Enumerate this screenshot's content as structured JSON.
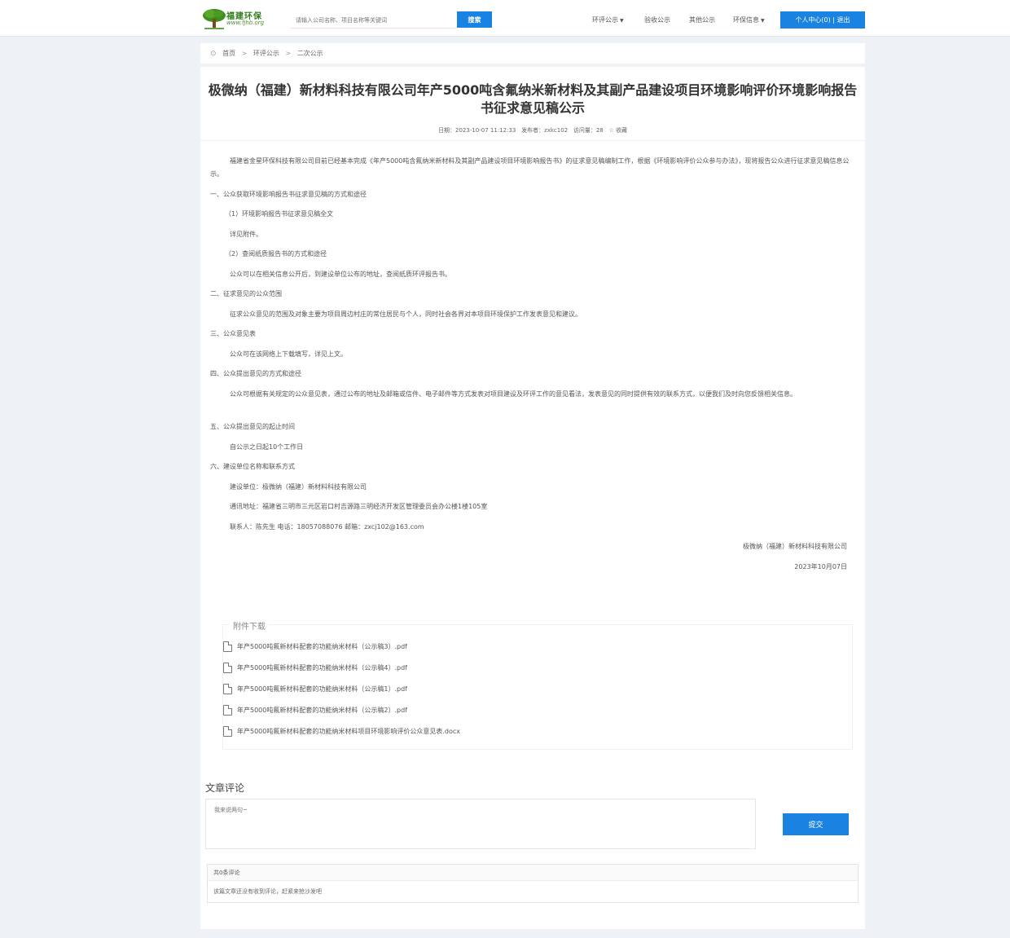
{
  "header": {
    "logo_text": "福建环保",
    "logo_domain": "www.fjhb.org",
    "search_placeholder": "请输入公司名称、项目名称等关键词",
    "search_button": "搜索",
    "nav": [
      {
        "label": "环评公示",
        "dropdown": true
      },
      {
        "label": "验收公示",
        "dropdown": false
      },
      {
        "label": "其他公示",
        "dropdown": false
      },
      {
        "label": "环保信息",
        "dropdown": true
      }
    ],
    "user_button": "个人中心(0) | 退出"
  },
  "breadcrumb": [
    "首页",
    "环评公示",
    "二次公示"
  ],
  "article": {
    "title": "极微纳（福建）新材料科技有限公司年产5000吨含氟纳米新材料及其副产品建设项目环境影响评价环境影响报告书征求意见稿公示",
    "meta": {
      "date": "日期：2023-10-07 11:12:33",
      "publisher": "发布者：zxkc102",
      "views": "访问量：28",
      "favorite": "收藏"
    },
    "paragraphs": [
      "福建省金星环保科技有限公司目前已经基本完成《年产5000吨含氟纳米新材料及其副产品建设项目环境影响报告书》的征求意见稿编制工作，根据《环境影响评价公众参与办法》，现将报告公众进行征求意见稿信息公示。",
      "一、公众获取环境影响报告书征求意见稿的方式和途径",
      "（1）环境影响报告书征求意见稿全文",
      "详见附件。",
      "（2）查阅纸质报告书的方式和途径",
      "公众可以在相关信息公开后，到建设单位公布的地址，查阅纸质环评报告书。",
      "二、征求意见的公众范围",
      "征求公众意见的范围及对象主要为项目周边村庄的常住居民与个人，同时社会各界对本项目环境保护工作发表意见和建议。",
      "三、公众意见表",
      "公众可在该网络上下载填写，详见上文。",
      "四、公众提出意见的方式和途径",
      "公众可根据有关规定的公众意见表，通过公布的地址及邮箱或信件、电子邮件等方式发表对项目建设及环评工作的意见看法，发表意见的同时提供有效的联系方式，以便我们及时向您反馈相关信息。",
      "五、公众提出意见的起止时间",
      "自公示之日起10个工作日",
      "六、建设单位名称和联系方式",
      "建设单位：极微纳（福建）新材料科技有限公司",
      "通讯地址：福建省三明市三元区岩口村吉源路三明经济开发区管理委员会办公楼1楼105室",
      "联系人：陈先生  电话：18057088076  邮箱：zxcj102@163.com",
      "极微纳（福建）新材料科技有限公司",
      "2023年10月07日"
    ]
  },
  "attachments": {
    "title": "附件下载",
    "files": [
      "年产5000吨氟新材料配套的功能纳米材料（公示稿3）.pdf",
      "年产5000吨氟新材料配套的功能纳米材料（公示稿4）.pdf",
      "年产5000吨氟新材料配套的功能纳米材料（公示稿1）.pdf",
      "年产5000吨氟新材料配套的功能纳米材料（公示稿2）.pdf",
      "年产5000吨氟新材料配套的功能纳米材料项目环境影响评价公众意见表.docx"
    ]
  },
  "comments": {
    "heading": "文章评论",
    "placeholder": "我来说两句~",
    "submit": "提交",
    "count_label": "共0条评论",
    "empty_text": "该篇文章还没有收到评论，赶紧来抢沙发吧"
  }
}
